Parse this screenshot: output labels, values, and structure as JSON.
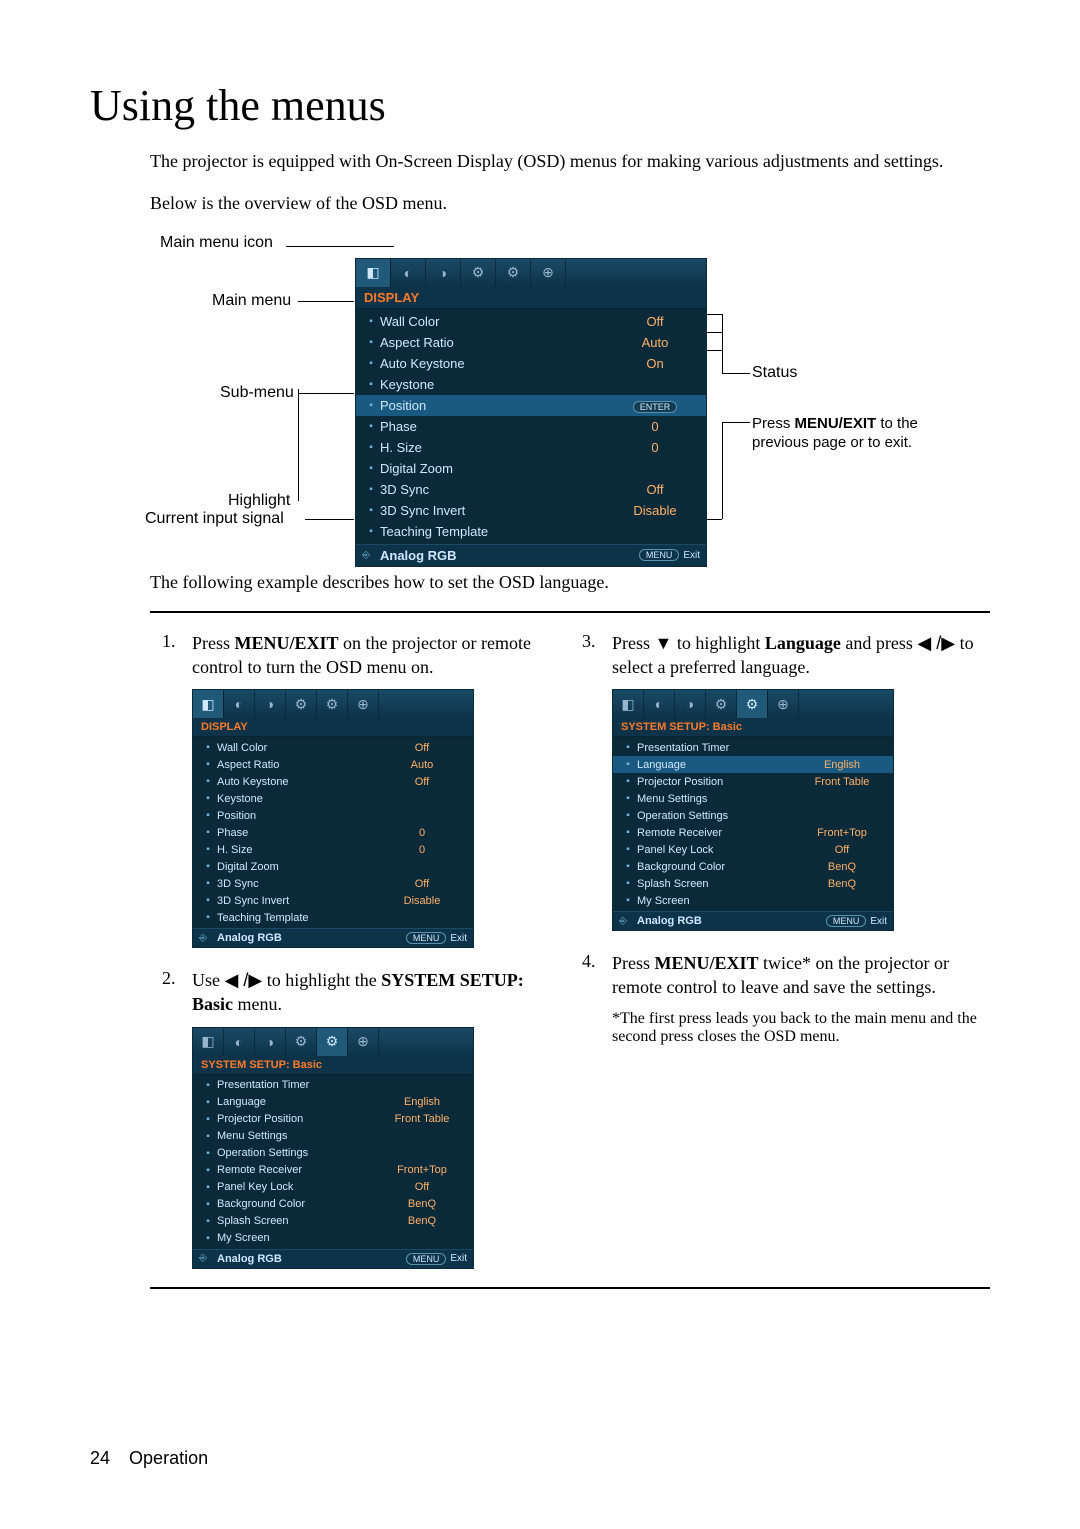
{
  "page": {
    "title": "Using the menus",
    "intro1": "The projector is equipped with On-Screen Display (OSD) menus for making various adjustments and settings.",
    "intro2": "Below is the overview of the OSD menu.",
    "instr": "The following example describes how to set the OSD language.",
    "page_number": "24",
    "section": "Operation"
  },
  "labels": {
    "main_icon": "Main menu icon",
    "main_menu": "Main menu",
    "sub_menu": "Sub-menu",
    "highlight": "Highlight",
    "current_input": "Current input signal",
    "status": "Status",
    "press_menu": "Press MENU/EXIT to the previous page or to exit."
  },
  "osd_display": {
    "title": "DISPLAY",
    "items": [
      {
        "name": "Wall Color",
        "value": "Off"
      },
      {
        "name": "Aspect Ratio",
        "value": "Auto"
      },
      {
        "name": "Auto Keystone",
        "value": "On"
      },
      {
        "name": "Keystone",
        "value": ""
      },
      {
        "name": "Position",
        "value": "",
        "enter": true,
        "highlight": true
      },
      {
        "name": "Phase",
        "value": "0"
      },
      {
        "name": "H. Size",
        "value": "0"
      },
      {
        "name": "Digital Zoom",
        "value": ""
      },
      {
        "name": "3D Sync",
        "value": "Off"
      },
      {
        "name": "3D Sync Invert",
        "value": "Disable"
      },
      {
        "name": "Teaching Template",
        "value": ""
      }
    ],
    "footer_input": "Analog RGB",
    "footer_menu": "MENU",
    "footer_exit": "Exit",
    "enter_label": "ENTER"
  },
  "osd_display_small": {
    "title": "DISPLAY",
    "items": [
      {
        "name": "Wall Color",
        "value": "Off"
      },
      {
        "name": "Aspect Ratio",
        "value": "Auto"
      },
      {
        "name": "Auto Keystone",
        "value": "Off"
      },
      {
        "name": "Keystone",
        "value": ""
      },
      {
        "name": "Position",
        "value": ""
      },
      {
        "name": "Phase",
        "value": "0"
      },
      {
        "name": "H. Size",
        "value": "0"
      },
      {
        "name": "Digital Zoom",
        "value": ""
      },
      {
        "name": "3D Sync",
        "value": "Off"
      },
      {
        "name": "3D Sync Invert",
        "value": "Disable"
      },
      {
        "name": "Teaching Template",
        "value": ""
      }
    ],
    "footer_input": "Analog RGB",
    "footer_menu": "MENU",
    "footer_exit": "Exit"
  },
  "osd_system": {
    "title": "SYSTEM SETUP: Basic",
    "items": [
      {
        "name": "Presentation Timer",
        "value": ""
      },
      {
        "name": "Language",
        "value": "English"
      },
      {
        "name": "Projector Position",
        "value": "Front Table"
      },
      {
        "name": "Menu Settings",
        "value": ""
      },
      {
        "name": "Operation Settings",
        "value": ""
      },
      {
        "name": "Remote Receiver",
        "value": "Front+Top"
      },
      {
        "name": "Panel Key Lock",
        "value": "Off"
      },
      {
        "name": "Background Color",
        "value": "BenQ"
      },
      {
        "name": "Splash Screen",
        "value": "BenQ"
      },
      {
        "name": "My Screen",
        "value": ""
      }
    ],
    "footer_input": "Analog RGB",
    "footer_menu": "MENU",
    "footer_exit": "Exit"
  },
  "osd_system_hl": {
    "title": "SYSTEM SETUP: Basic",
    "items": [
      {
        "name": "Presentation Timer",
        "value": ""
      },
      {
        "name": "Language",
        "value": "English",
        "highlight": true
      },
      {
        "name": "Projector Position",
        "value": "Front Table"
      },
      {
        "name": "Menu Settings",
        "value": ""
      },
      {
        "name": "Operation Settings",
        "value": ""
      },
      {
        "name": "Remote Receiver",
        "value": "Front+Top"
      },
      {
        "name": "Panel Key Lock",
        "value": "Off"
      },
      {
        "name": "Background Color",
        "value": "BenQ"
      },
      {
        "name": "Splash Screen",
        "value": "BenQ"
      },
      {
        "name": "My Screen",
        "value": ""
      }
    ],
    "footer_input": "Analog RGB",
    "footer_menu": "MENU",
    "footer_exit": "Exit"
  },
  "steps": {
    "s1a": "Press ",
    "s1b": "MENU/EXIT",
    "s1c": " on the projector or remote control to turn the OSD menu on.",
    "s2a": "Use ",
    "s2b": " to highlight the ",
    "s2c": "SYSTEM SETUP: Basic",
    "s2d": " menu.",
    "s3a": "Press ",
    "s3b": " to highlight ",
    "s3c": "Language",
    "s3d": " and press ",
    "s3e": " to select a preferred language.",
    "s4a": "Press ",
    "s4b": "MENU/EXIT",
    "s4c": " twice* on the projector or remote control to leave and save the settings.",
    "s4note": "*The first press leads you back to the main menu and the second press closes the OSD menu."
  }
}
